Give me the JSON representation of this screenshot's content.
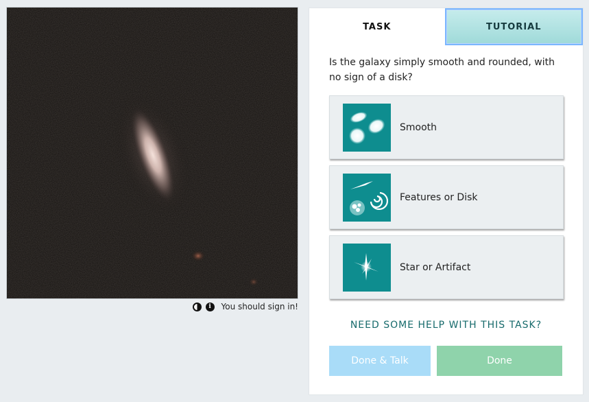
{
  "viewer": {
    "alt": "Galaxy subject image",
    "sign_in_note": "You should sign in!",
    "invert_icon": "contrast-icon",
    "info_icon": "info-icon"
  },
  "tabs": {
    "task": "TASK",
    "tutorial": "TUTORIAL",
    "active": "tutorial"
  },
  "task": {
    "question": "Is the galaxy simply smooth and rounded, with no sign of a disk?",
    "answers": [
      {
        "label": "Smooth",
        "icon": "smooth-galaxy-icon"
      },
      {
        "label": "Features or Disk",
        "icon": "disk-galaxy-icon"
      },
      {
        "label": "Star or Artifact",
        "icon": "star-icon"
      }
    ],
    "help": "NEED SOME HELP WITH THIS TASK?",
    "done_talk": "Done & Talk",
    "done": "Done"
  },
  "colors": {
    "teal": "#0e8d8f",
    "tutorial_tab": "#a9dfde",
    "done_talk": "#a9dcf8",
    "done": "#8fd3ab",
    "help_text": "#166a6b"
  }
}
